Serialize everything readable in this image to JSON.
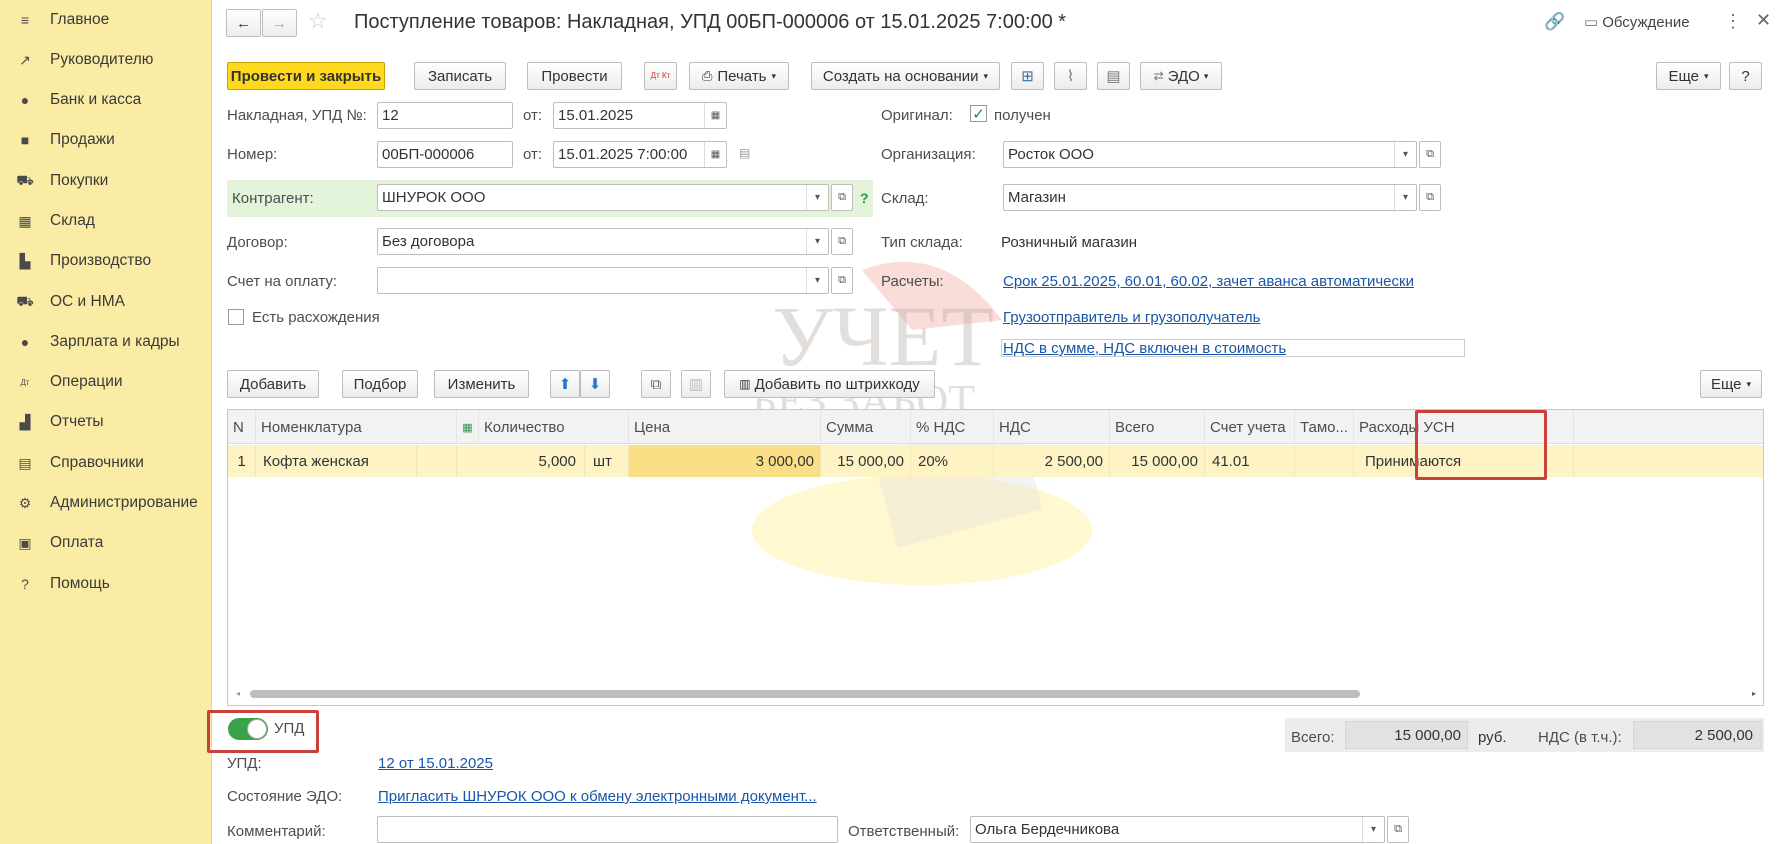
{
  "sidebar": {
    "items": [
      {
        "label": "Главное",
        "icon": "menu-icon",
        "glyph": "≡"
      },
      {
        "label": "Руководителю",
        "icon": "trend-icon",
        "glyph": "↗"
      },
      {
        "label": "Банк и касса",
        "icon": "coin-icon",
        "glyph": "●"
      },
      {
        "label": "Продажи",
        "icon": "bag-icon",
        "glyph": "■"
      },
      {
        "label": "Покупки",
        "icon": "cart-icon",
        "glyph": "⛟"
      },
      {
        "label": "Склад",
        "icon": "warehouse-icon",
        "glyph": "▦"
      },
      {
        "label": "Производство",
        "icon": "factory-icon",
        "glyph": "▙"
      },
      {
        "label": "ОС и НМА",
        "icon": "truck-icon",
        "glyph": "⛟"
      },
      {
        "label": "Зарплата и кадры",
        "icon": "person-icon",
        "glyph": "●"
      },
      {
        "label": "Операции",
        "icon": "dt-kt-icon",
        "glyph": "Дт"
      },
      {
        "label": "Отчеты",
        "icon": "bar-chart-icon",
        "glyph": "▟"
      },
      {
        "label": "Справочники",
        "icon": "books-icon",
        "glyph": "▤"
      },
      {
        "label": "Администрирование",
        "icon": "gear-icon",
        "glyph": "⚙"
      },
      {
        "label": "Оплата",
        "icon": "wallet-icon",
        "glyph": "▣"
      },
      {
        "label": "Помощь",
        "icon": "question-icon",
        "glyph": "?"
      }
    ]
  },
  "header": {
    "title": "Поступление товаров: Накладная, УПД 00БП-000006 от 15.01.2025 7:00:00 *",
    "discussion": "Обсуждение"
  },
  "toolbar": {
    "post_close": "Провести и закрыть",
    "save": "Записать",
    "post": "Провести",
    "dt_kt": "Дт Кт",
    "print": "Печать",
    "create_based": "Создать на основании",
    "edo": "ЭДО",
    "more": "Еще",
    "help": "?"
  },
  "form": {
    "invoice_label": "Накладная, УПД №:",
    "invoice_no": "12",
    "from_label": "от:",
    "invoice_date": "15.01.2025",
    "number_label": "Номер:",
    "number": "00БП-000006",
    "number_date": "15.01.2025  7:00:00",
    "original_label": "Оригинал:",
    "original_value": "получен",
    "org_label": "Организация:",
    "org_value": "Росток ООО",
    "contractor_label": "Контрагент:",
    "contractor_value": "ШНУРОК ООО",
    "warehouse_label": "Склад:",
    "warehouse_value": "Магазин",
    "contract_label": "Договор:",
    "contract_value": "Без договора",
    "warehouse_type_label": "Тип склада:",
    "warehouse_type_value": "Розничный магазин",
    "payment_invoice_label": "Счет на оплату:",
    "payment_invoice_value": "",
    "settlements_label": "Расчеты:",
    "settlements_link": "Срок 25.01.2025, 60.01, 60.02, зачет аванса автоматически",
    "discrepancy_label": "Есть расхождения",
    "consignor_link": "Грузоотправитель и грузополучатель",
    "vat_link": "НДС в сумме, НДС включен в стоимость"
  },
  "table_toolbar": {
    "add": "Добавить",
    "pick": "Подбор",
    "change": "Изменить",
    "barcode": "Добавить по штрихкоду",
    "more": "Еще"
  },
  "table": {
    "columns": [
      "N",
      "Номенклатура",
      "Количество",
      "Цена",
      "Сумма",
      "% НДС",
      "НДС",
      "Всего",
      "Счет учета",
      "Тамо...",
      "Расходы УСН"
    ],
    "rows": [
      {
        "n": "1",
        "item": "Кофта женская",
        "qty": "5,000",
        "unit": "шт",
        "price": "3 000,00",
        "sum": "15 000,00",
        "vat_rate": "20%",
        "vat": "2 500,00",
        "total": "15 000,00",
        "account": "41.01",
        "customs": "",
        "usn": "Принимаются"
      }
    ]
  },
  "footer": {
    "upd_toggle": "УПД",
    "total_label": "Всего:",
    "total_value": "15 000,00",
    "currency": "руб.",
    "vat_label": "НДС (в т.ч.):",
    "vat_value": "2 500,00",
    "upd_label": "УПД:",
    "upd_link": "12 от 15.01.2025",
    "edo_state_label": "Состояние ЭДО:",
    "edo_state_link": "Пригласить ШНУРОК ООО к обмену электронными документ...",
    "comment_label": "Комментарий:",
    "comment_value": "",
    "responsible_label": "Ответственный:",
    "responsible_value": "Ольга Бердечникова"
  },
  "watermark": {
    "line1": "УЧЕТ",
    "line2": "БЕЗ ЗАБОТ"
  },
  "colors": {
    "sidebar": "#fbeca5",
    "primary": "#ffd91f",
    "highlight": "#c8413b",
    "link": "#1a56a8"
  }
}
